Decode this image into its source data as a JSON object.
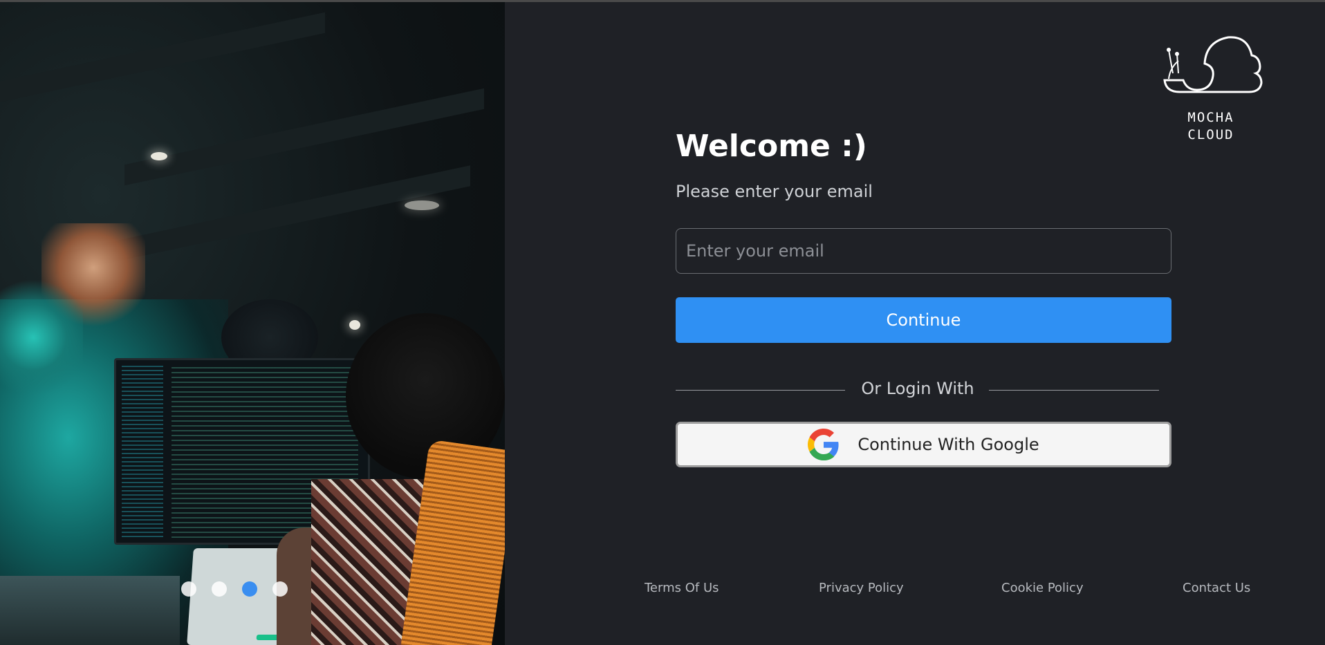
{
  "hero": {
    "image": "office-developer-photo",
    "carousel_slide_count": 4,
    "carousel_active_index": 2
  },
  "logo": {
    "icon": "snail-cloud-logo",
    "line1": "MOCHA",
    "line2": "CLOUD"
  },
  "form": {
    "title": "Welcome :)",
    "subtitle": "Please enter your email",
    "email_placeholder": "Enter your email",
    "email_value": "",
    "continue_label": "Continue",
    "divider_label": "Or Login With",
    "google_label": "Continue With Google",
    "google_icon": "google-icon"
  },
  "footer": {
    "terms": "Terms Of Us",
    "privacy": "Privacy Policy",
    "cookie": "Cookie Policy",
    "contact": "Contact Us"
  },
  "colors": {
    "background": "#1f2126",
    "primary": "#2f90f3",
    "carousel_active": "#3a8ef0"
  }
}
